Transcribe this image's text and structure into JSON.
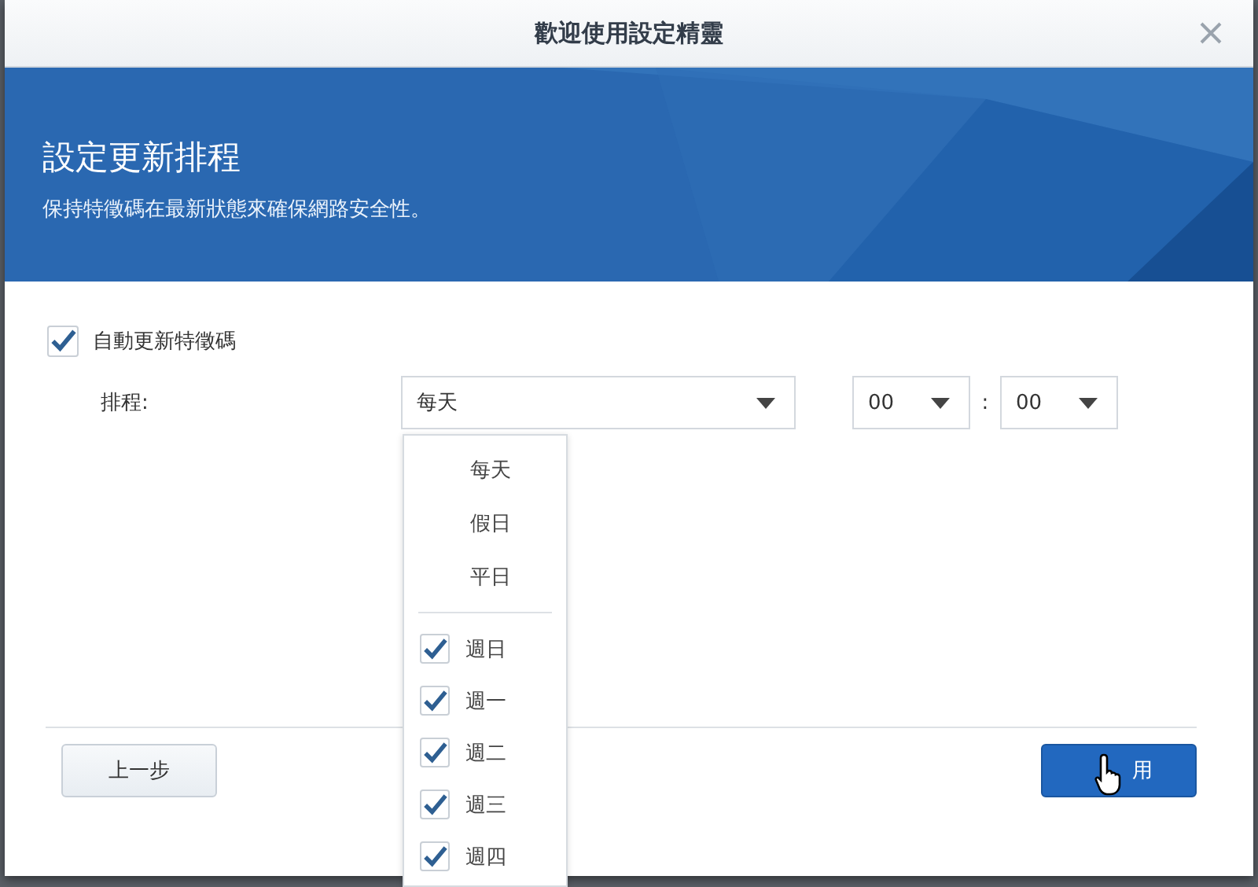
{
  "window": {
    "title": "歡迎使用設定精靈"
  },
  "header": {
    "title": "設定更新排程",
    "subtitle": "保持特徵碼在最新狀態來確保網路安全性。"
  },
  "auto_update": {
    "label": "自動更新特徵碼",
    "checked": true
  },
  "schedule": {
    "label": "排程:",
    "value": "每天",
    "hour": "00",
    "separator": ":",
    "minute": "00"
  },
  "dropdown": {
    "items": [
      {
        "kind": "option",
        "label": "每天"
      },
      {
        "kind": "option",
        "label": "假日"
      },
      {
        "kind": "option",
        "label": "平日"
      },
      {
        "kind": "divider"
      },
      {
        "kind": "check",
        "label": "週日",
        "checked": true
      },
      {
        "kind": "check",
        "label": "週一",
        "checked": true
      },
      {
        "kind": "check",
        "label": "週二",
        "checked": true
      },
      {
        "kind": "check",
        "label": "週三",
        "checked": true
      },
      {
        "kind": "check",
        "label": "週四",
        "checked": true
      }
    ]
  },
  "buttons": [
    {
      "kind": "secondary",
      "label": "上一步"
    },
    {
      "kind": "primary",
      "label": "用"
    }
  ]
}
